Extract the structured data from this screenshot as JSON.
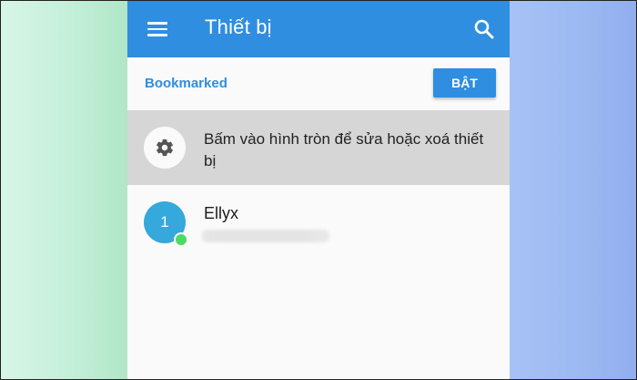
{
  "appbar": {
    "title": "Thiết bị",
    "color": "#2f8ee0",
    "menu_icon": "hamburger-menu-icon",
    "search_icon": "search-icon"
  },
  "bookmarked": {
    "title": "Bookmarked",
    "toggle_label": "BẬT"
  },
  "hint": {
    "icon": "gear-icon",
    "text": "Bấm vào hình tròn để sửa hoặc xoá thiết bị"
  },
  "devices": [
    {
      "number": "1",
      "name": "Ellyx",
      "status": "online",
      "avatar_color": "#35a8dc",
      "status_color": "#4cd964"
    }
  ]
}
